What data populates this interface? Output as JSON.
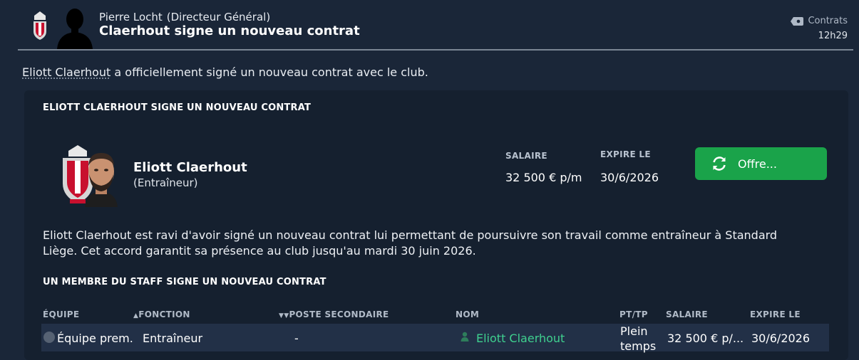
{
  "header": {
    "sender_name": "Pierre Locht",
    "sender_role": "(Directeur Général)",
    "subject": "Claerhout signe un nouveau contrat",
    "category": "Contrats",
    "category_icon": "tag-icon",
    "time": "12h29"
  },
  "intro": {
    "name": "Eliott Claerhout",
    "rest": " a officiellement signé un nouveau contrat avec le club."
  },
  "section1": {
    "title": "ELIOTT CLAERHOUT SIGNE UN NOUVEAU CONTRAT",
    "person_name": "Eliott Claerhout",
    "person_role": "(Entraîneur)",
    "salary_label": "SALAIRE",
    "salary_value": "32 500 € p/m",
    "expires_label": "EXPIRE LE",
    "expires_value": "30/6/2026",
    "offer_button": "Offre...",
    "description": "Eliott Claerhout est ravi d'avoir signé un nouveau contrat lui permettant de poursuivre son travail comme entraîneur à Standard Liège. Cet accord garantit sa présence au club jusqu'au mardi 30 juin 2026."
  },
  "section2": {
    "title": "UN MEMBRE DU STAFF SIGNE UN NOUVEAU CONTRAT",
    "columns": [
      "ÉQUIPE",
      "FONCTION",
      "POSTE SECONDAIRE",
      "NOM",
      "PT/TP",
      "SALAIRE",
      "EXPIRE LE"
    ],
    "row": {
      "team": "Équipe prem.",
      "function": "Entraîneur",
      "secondary": "-",
      "name": "Eliott Claerhout",
      "pt_line1": "Plein",
      "pt_line2": "temps",
      "salary": "32 500 € p/...",
      "expires": "30/6/2026"
    }
  },
  "colors": {
    "background": "#1a2638",
    "panel": "#15202f",
    "accent_green": "#1aa34a",
    "link_green": "#3fd08f",
    "crest_red": "#c8102e"
  }
}
